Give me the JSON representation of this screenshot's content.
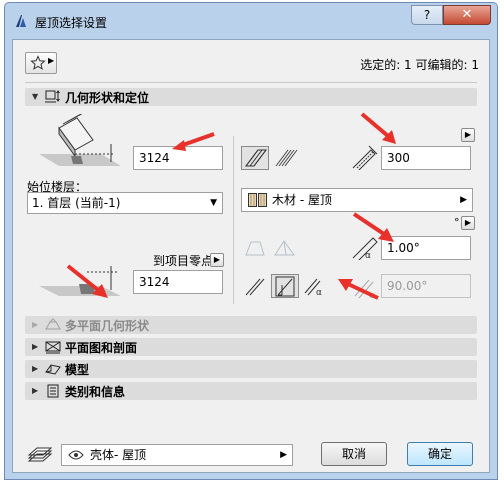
{
  "window": {
    "title": "屋顶选择设置",
    "help_label": "?",
    "close_label": "✕"
  },
  "selection_info": "选定的: 1 可编辑的: 1",
  "panels": {
    "geometry": "几何形状和定位",
    "multiplane": "多平面几何形状",
    "floorplan": "平面图和剖面",
    "model": "模型",
    "category": "类别和信息"
  },
  "geometry": {
    "offset_top": "3124",
    "home_story_label": "始位楼层：",
    "home_story_value": "1. 首层 (当前-1)",
    "reference_label": "到项目零点",
    "offset_bottom": "3124",
    "thickness": "300",
    "material": "木材 - 屋顶",
    "unit_mark": "°",
    "pitch": "1.00°",
    "angle_disabled": "90.00°"
  },
  "footer": {
    "layer_value": "壳体- 屋顶",
    "cancel_label": "取消",
    "ok_label": "确定"
  },
  "colors": {
    "title_bar": "#b9d1ea",
    "dialog_bg": "#f0f0f0",
    "arrow": "#e8312a",
    "default_button": "#bee6fd"
  }
}
